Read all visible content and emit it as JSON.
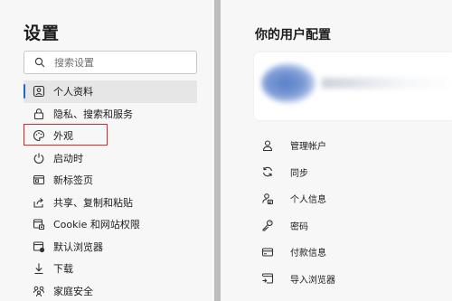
{
  "settings": {
    "title": "设置",
    "search_placeholder": "搜索设置",
    "nav_items": [
      {
        "label": "个人资料",
        "icon": "profile-icon",
        "active": true
      },
      {
        "label": "隐私、搜索和服务",
        "icon": "lock-icon"
      },
      {
        "label": "外观",
        "icon": "palette-icon"
      },
      {
        "label": "启动时",
        "icon": "power-icon"
      },
      {
        "label": "新标签页",
        "icon": "new-tab-icon"
      },
      {
        "label": "共享、复制和粘贴",
        "icon": "share-icon"
      },
      {
        "label": "Cookie 和网站权限",
        "icon": "site-permissions-icon"
      },
      {
        "label": "默认浏览器",
        "icon": "default-browser-icon"
      },
      {
        "label": "下载",
        "icon": "download-icon"
      },
      {
        "label": "家庭安全",
        "icon": "family-icon"
      }
    ]
  },
  "profile": {
    "title": "你的用户配置",
    "menu_items": [
      {
        "label": "管理帐户",
        "icon": "person-icon"
      },
      {
        "label": "同步",
        "icon": "sync-icon"
      },
      {
        "label": "个人信息",
        "icon": "personal-info-icon"
      },
      {
        "label": "密码",
        "icon": "key-icon"
      },
      {
        "label": "付款信息",
        "icon": "card-icon"
      },
      {
        "label": "导入浏览器",
        "icon": "import-icon"
      }
    ]
  },
  "colors": {
    "accent": "#1a6bd1",
    "highlight_box": "#e0262d"
  }
}
